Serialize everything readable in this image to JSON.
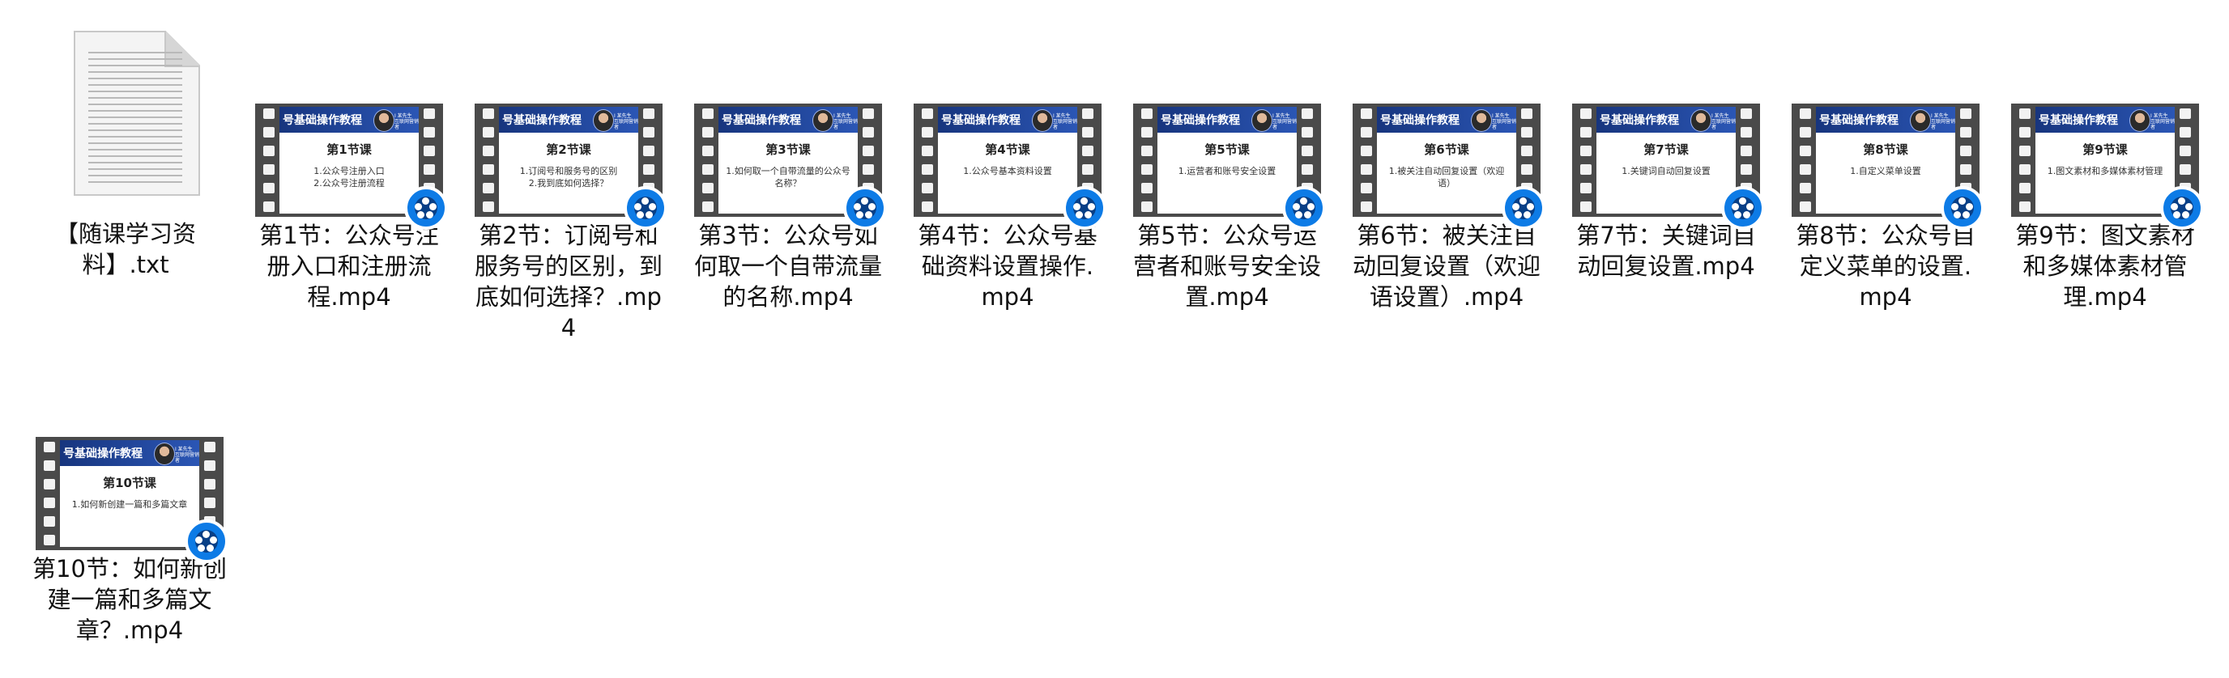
{
  "files": [
    {
      "type": "txt",
      "name": "【随课学习资料】.txt"
    },
    {
      "type": "mp4",
      "name": "第1节：公众号注册入口和注册流程.mp4",
      "lesson": "第1节课",
      "topic": "1.公众号注册入口\n2.公众号注册流程"
    },
    {
      "type": "mp4",
      "name": "第2节：订阅号和服务号的区别，到底如何选择？.mp4",
      "lesson": "第2节课",
      "topic": "1.订阅号和服务号的区别\n2.我到底如何选择？"
    },
    {
      "type": "mp4",
      "name": "第3节：公众号如何取一个自带流量的名称.mp4",
      "lesson": "第3节课",
      "topic": "1.如何取一个自带流量的公众号名称？"
    },
    {
      "type": "mp4",
      "name": "第4节：公众号基础资料设置操作.mp4",
      "lesson": "第4节课",
      "topic": "1.公众号基本资料设置"
    },
    {
      "type": "mp4",
      "name": "第5节：公众号运营者和账号安全设置.mp4",
      "lesson": "第5节课",
      "topic": "1.运营者和账号安全设置"
    },
    {
      "type": "mp4",
      "name": "第6节：被关注自动回复设置（欢迎语设置）.mp4",
      "lesson": "第6节课",
      "topic": "1.被关注自动回复设置（欢迎语）"
    },
    {
      "type": "mp4",
      "name": "第7节：关键词自动回复设置.mp4",
      "lesson": "第7节课",
      "topic": "1.关键词自动回复设置"
    },
    {
      "type": "mp4",
      "name": "第8节：公众号自定义菜单的设置.mp4",
      "lesson": "第8节课",
      "topic": "1.自定义菜单设置"
    },
    {
      "type": "mp4",
      "name": "第9节：图文素材和多媒体素材管理.mp4",
      "lesson": "第9节课",
      "topic": "1.图文素材和多媒体素材管理"
    },
    {
      "type": "mp4",
      "name": "第10节：如何新创建一篇和多篇文章？.mp4",
      "lesson": "第10节课",
      "topic": "1.如何新创建一篇和多篇文章"
    }
  ],
  "thumbnail": {
    "header": "号基础操作教程",
    "presenter": "I 某先生\n互联网营销者"
  },
  "icons": {
    "txt": "text-file-icon",
    "mp4": "video-player-badge-icon"
  },
  "colors": {
    "slide_header": "#1c3f8f",
    "badge": "#0d7be6"
  }
}
